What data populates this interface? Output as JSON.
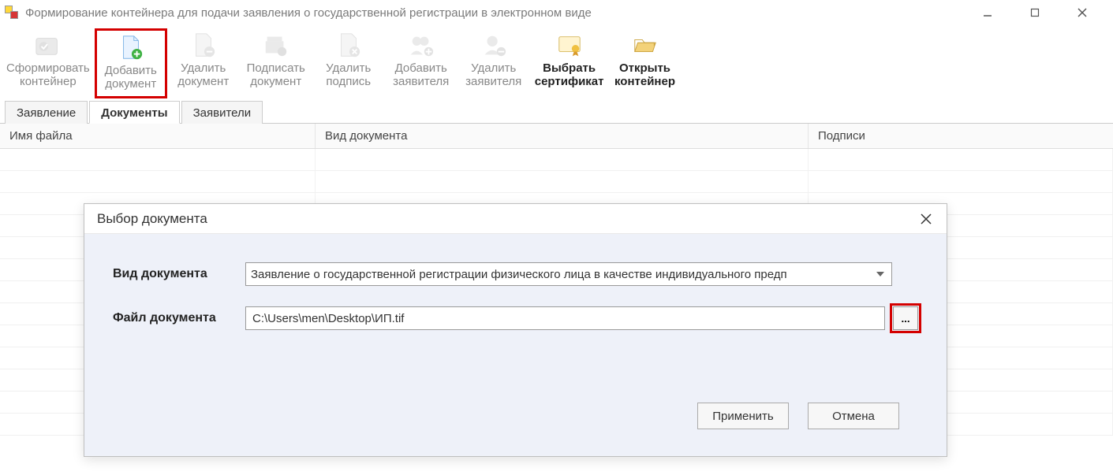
{
  "window": {
    "title": "Формирование контейнера для подачи заявления о государственной регистрации в электронном виде"
  },
  "toolbar": [
    {
      "l1": "Сформировать",
      "l2": "контейнер"
    },
    {
      "l1": "Добавить",
      "l2": "документ"
    },
    {
      "l1": "Удалить",
      "l2": "документ"
    },
    {
      "l1": "Подписать",
      "l2": "документ"
    },
    {
      "l1": "Удалить",
      "l2": "подпись"
    },
    {
      "l1": "Добавить",
      "l2": "заявителя"
    },
    {
      "l1": "Удалить",
      "l2": "заявителя"
    },
    {
      "l1": "Выбрать",
      "l2": "сертификат"
    },
    {
      "l1": "Открыть",
      "l2": "контейнер"
    }
  ],
  "tabs": {
    "application": "Заявление",
    "documents": "Документы",
    "applicants": "Заявители"
  },
  "columns": {
    "filename": "Имя файла",
    "doctype": "Вид документа",
    "signs": "Подписи"
  },
  "dialog": {
    "title": "Выбор документа",
    "labels": {
      "doctype": "Вид документа",
      "file": "Файл документа"
    },
    "doctype_value": "Заявление о государственной регистрации физического лица в качестве индивидуального предп",
    "file_value": "C:\\Users\\men\\Desktop\\ИП.tif",
    "browse": "...",
    "apply": "Применить",
    "cancel": "Отмена"
  }
}
